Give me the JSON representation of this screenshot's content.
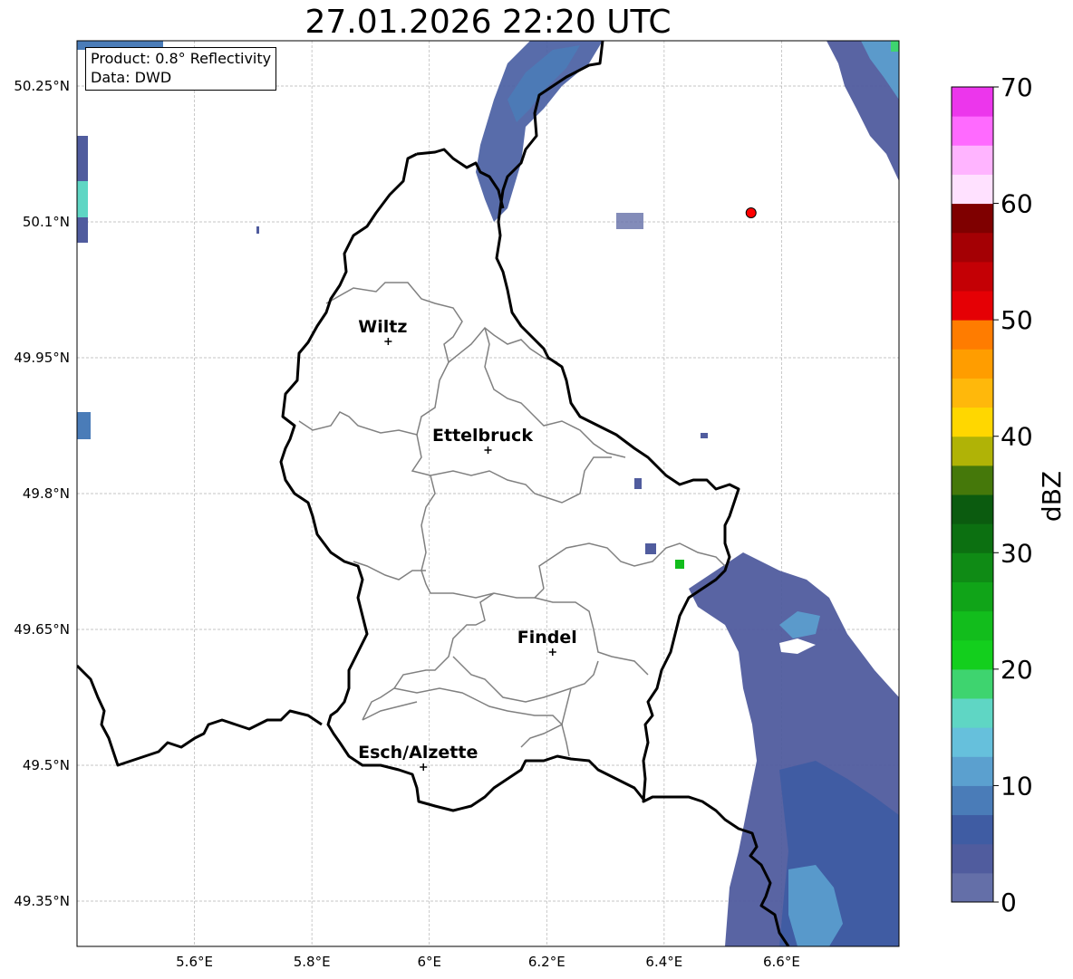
{
  "title": "27.01.2026 22:20 UTC",
  "info": {
    "product": "Product: 0.8° Reflectivity",
    "data": "Data: DWD"
  },
  "axes": {
    "lon_ticks": [
      5.6,
      5.8,
      6.0,
      6.2,
      6.4,
      6.6
    ],
    "lon_tick_labels": [
      "5.6°E",
      "5.8°E",
      "6°E",
      "6.2°E",
      "6.4°E",
      "6.6°E"
    ],
    "lat_ticks": [
      50.25,
      50.1,
      49.95,
      49.8,
      49.65,
      49.5,
      49.35
    ],
    "lat_tick_labels": [
      "50.25°N",
      "50.1°N",
      "49.95°N",
      "49.8°N",
      "49.65°N",
      "49.5°N",
      "49.35°N"
    ],
    "lon_range": [
      5.4,
      6.8
    ],
    "lat_range": [
      49.3,
      50.3
    ],
    "grid": true
  },
  "cities": [
    {
      "name": "Wiltz",
      "lon": 5.93,
      "lat": 49.968
    },
    {
      "name": "Ettelbruck",
      "lon": 6.1,
      "lat": 49.848
    },
    {
      "name": "Findel",
      "lon": 6.21,
      "lat": 49.625
    },
    {
      "name": "Esch/Alzette",
      "lon": 5.99,
      "lat": 49.498
    }
  ],
  "radar_site": {
    "lon": 6.548,
    "lat": 50.11,
    "color": "#ff0000"
  },
  "colorbar": {
    "label": "dBZ",
    "ticks": [
      0,
      10,
      20,
      30,
      40,
      50,
      60,
      70
    ],
    "tick_labels": [
      "0",
      "10",
      "20",
      "30",
      "40",
      "50",
      "60",
      "70"
    ],
    "colors": [
      "#646fa8",
      "#505c9e",
      "#3f5ca3",
      "#4a7cb8",
      "#5ba0cf",
      "#66c0dc",
      "#5fd6c4",
      "#3ed46f",
      "#13cf1d",
      "#12bd1c",
      "#10a418",
      "#0f8b15",
      "#0c7011",
      "#0b5b0f",
      "#45780a",
      "#b0b306",
      "#ffd700",
      "#ffb80b",
      "#ff9d00",
      "#ff7c00",
      "#e50005",
      "#c40005",
      "#a40004",
      "#7f0000",
      "#ffe1ff",
      "#ffb4ff",
      "#ff6aff",
      "#ec36ec"
    ]
  }
}
